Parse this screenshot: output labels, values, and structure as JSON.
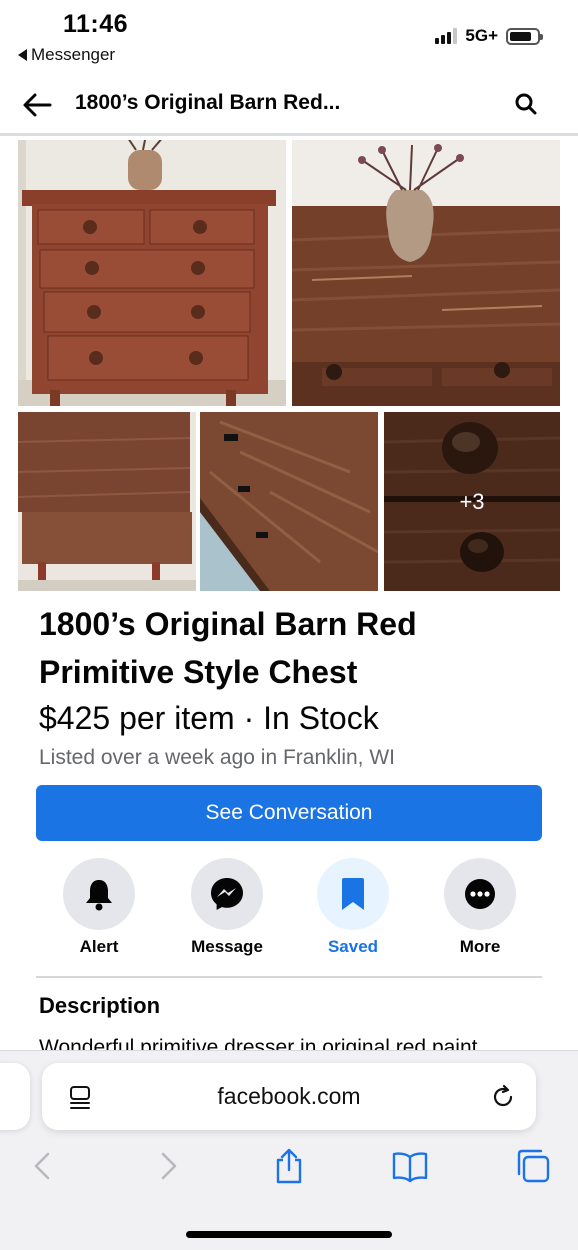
{
  "status_bar": {
    "time": "11:46",
    "back_app": "Messenger",
    "network": "5G+"
  },
  "header": {
    "title": "1800’s Original Barn Red..."
  },
  "gallery": {
    "more_count": "+3"
  },
  "listing": {
    "title": "1800’s Original Barn Red\n Primitive Style Chest",
    "price_line": "$425 per item · In Stock",
    "listed_line": "Listed over a week ago in Franklin, WI",
    "cta_label": "See Conversation"
  },
  "actions": [
    {
      "label": "Alert",
      "icon": "bell-icon"
    },
    {
      "label": "Message",
      "icon": "messenger-icon"
    },
    {
      "label": "Saved",
      "icon": "bookmark-icon"
    },
    {
      "label": "More",
      "icon": "more-dots-icon"
    }
  ],
  "description": {
    "heading": "Description",
    "text": "Wonderful primitive dresser in original red paint"
  },
  "browser": {
    "url": "facebook.com"
  },
  "colors": {
    "brand_blue": "#1b74e4",
    "secondary_text": "#65676b",
    "chip_gray": "#e4e6eb",
    "saved_bg": "#e7f3ff"
  }
}
